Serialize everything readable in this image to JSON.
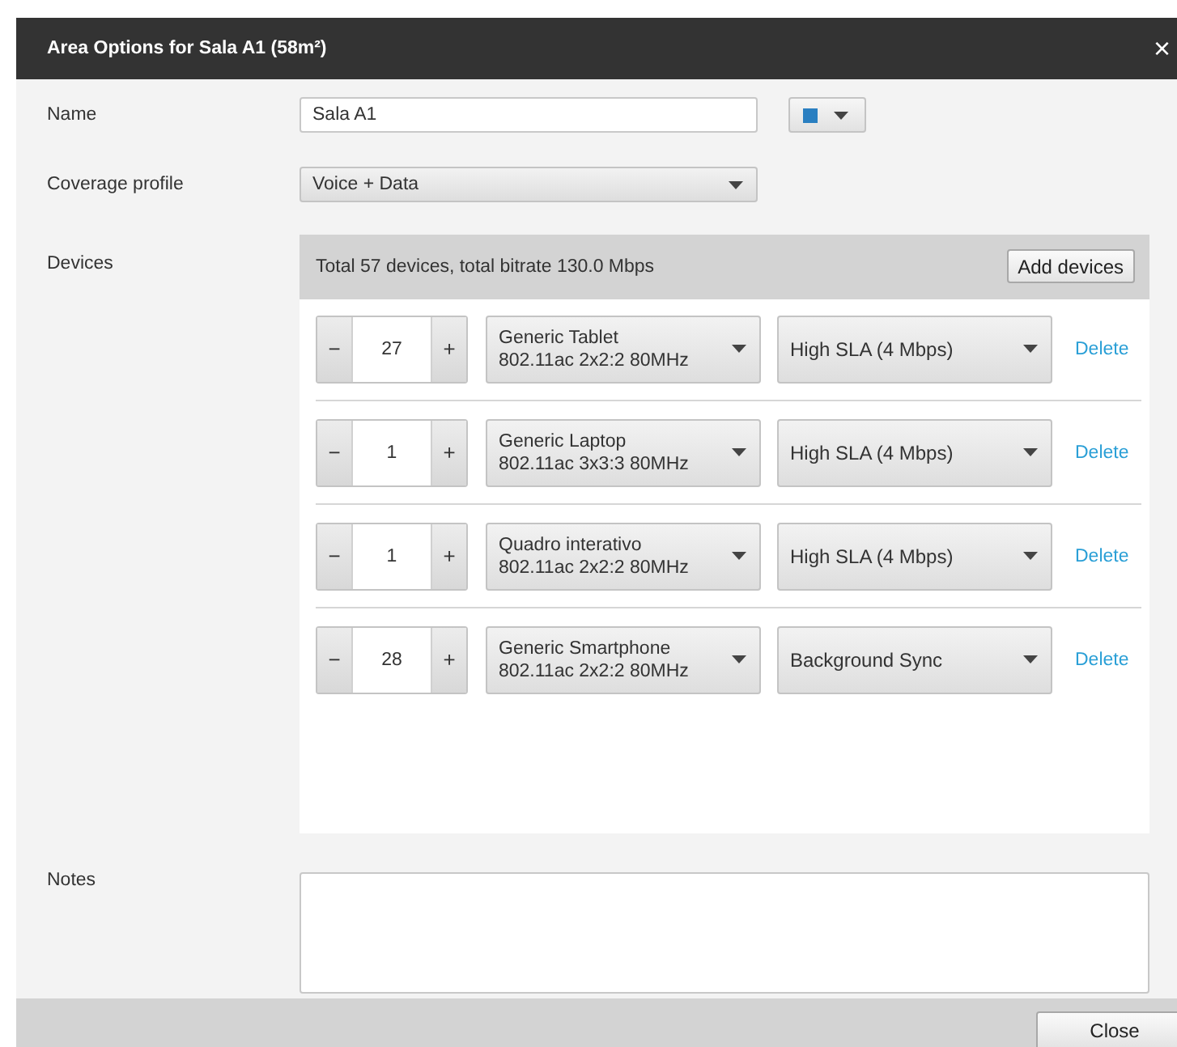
{
  "dialog": {
    "title": "Area Options for Sala A1 (58m²)",
    "close_icon": "×"
  },
  "name": {
    "label": "Name",
    "value": "Sala A1",
    "color": "#2a7fc1"
  },
  "coverage_profile": {
    "label": "Coverage profile",
    "value": "Voice + Data"
  },
  "devices": {
    "label": "Devices",
    "summary": "Total 57 devices, total bitrate 130.0 Mbps",
    "add_button": "Add devices",
    "rows": [
      {
        "minus": "−",
        "count": "27",
        "plus": "+",
        "device": "Generic Tablet",
        "spec": "802.11ac 2x2:2 80MHz",
        "sla": "High SLA (4 Mbps)",
        "delete": "Delete"
      },
      {
        "minus": "−",
        "count": "1",
        "plus": "+",
        "device": "Generic Laptop",
        "spec": "802.11ac 3x3:3 80MHz",
        "sla": "High SLA (4 Mbps)",
        "delete": "Delete"
      },
      {
        "minus": "−",
        "count": "1",
        "plus": "+",
        "device": "Quadro interativo",
        "spec": "802.11ac 2x2:2 80MHz",
        "sla": "High SLA (4 Mbps)",
        "delete": "Delete"
      },
      {
        "minus": "−",
        "count": "28",
        "plus": "+",
        "device": "Generic Smartphone",
        "spec": "802.11ac 2x2:2 80MHz",
        "sla": "Background Sync",
        "delete": "Delete"
      }
    ]
  },
  "notes": {
    "label": "Notes"
  },
  "footer": {
    "close_button": "Close"
  }
}
